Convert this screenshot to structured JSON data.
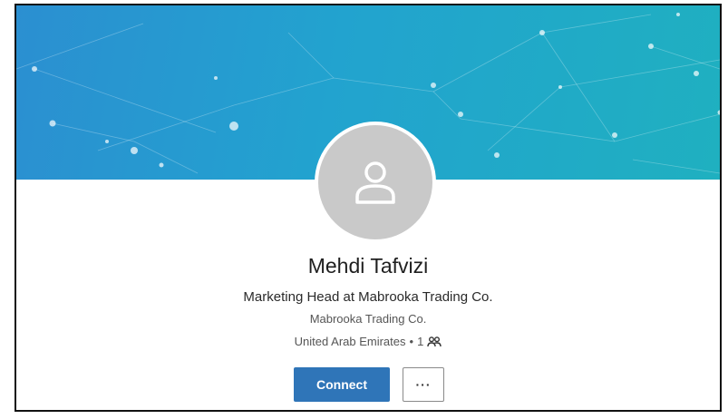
{
  "profile": {
    "name": "Mehdi Tafvizi",
    "headline": "Marketing Head at Mabrooka Trading Co.",
    "company": "Mabrooka Trading Co.",
    "location": "United Arab Emirates",
    "separator": "•",
    "connections": "1"
  },
  "actions": {
    "connect_label": "Connect",
    "more_label": "···"
  },
  "icons": {
    "avatar": "person-placeholder-icon",
    "connections": "people-icon",
    "more": "more-options-icon"
  },
  "colors": {
    "banner_start": "#2b8fd1",
    "banner_end": "#1fb0c0",
    "connect_button": "#2f75b8",
    "avatar_bg": "#c9c9c9"
  }
}
